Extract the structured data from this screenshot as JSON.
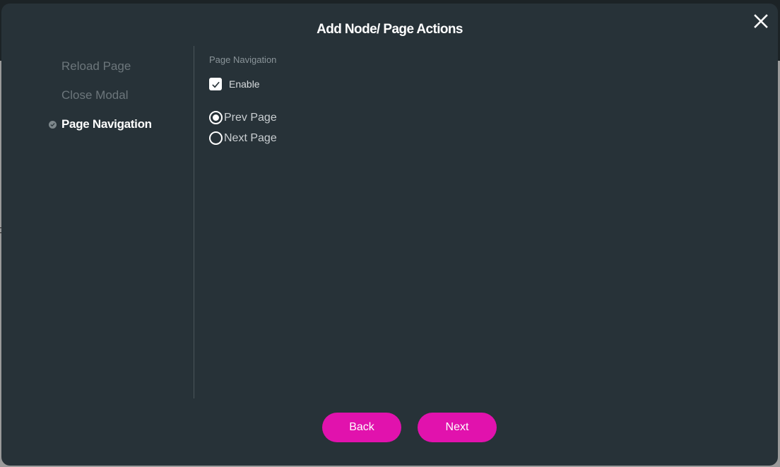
{
  "modal": {
    "title": "Add Node/ Page Actions",
    "close_icon": "close-icon"
  },
  "sidebar": {
    "items": [
      {
        "label": "Reload Page",
        "active": false
      },
      {
        "label": "Close Modal",
        "active": false
      },
      {
        "label": "Page Navigation",
        "active": true,
        "icon": "check-circle-icon"
      }
    ]
  },
  "page_navigation": {
    "section_label": "Page Navigation",
    "enable": {
      "label": "Enable",
      "checked": true
    },
    "options": [
      {
        "label": "Prev Page",
        "selected": true
      },
      {
        "label": "Next Page",
        "selected": false
      }
    ]
  },
  "footer": {
    "back_label": "Back",
    "next_label": "Next"
  },
  "colors": {
    "accent": "#e112ad",
    "modal_bg": "#273238"
  }
}
